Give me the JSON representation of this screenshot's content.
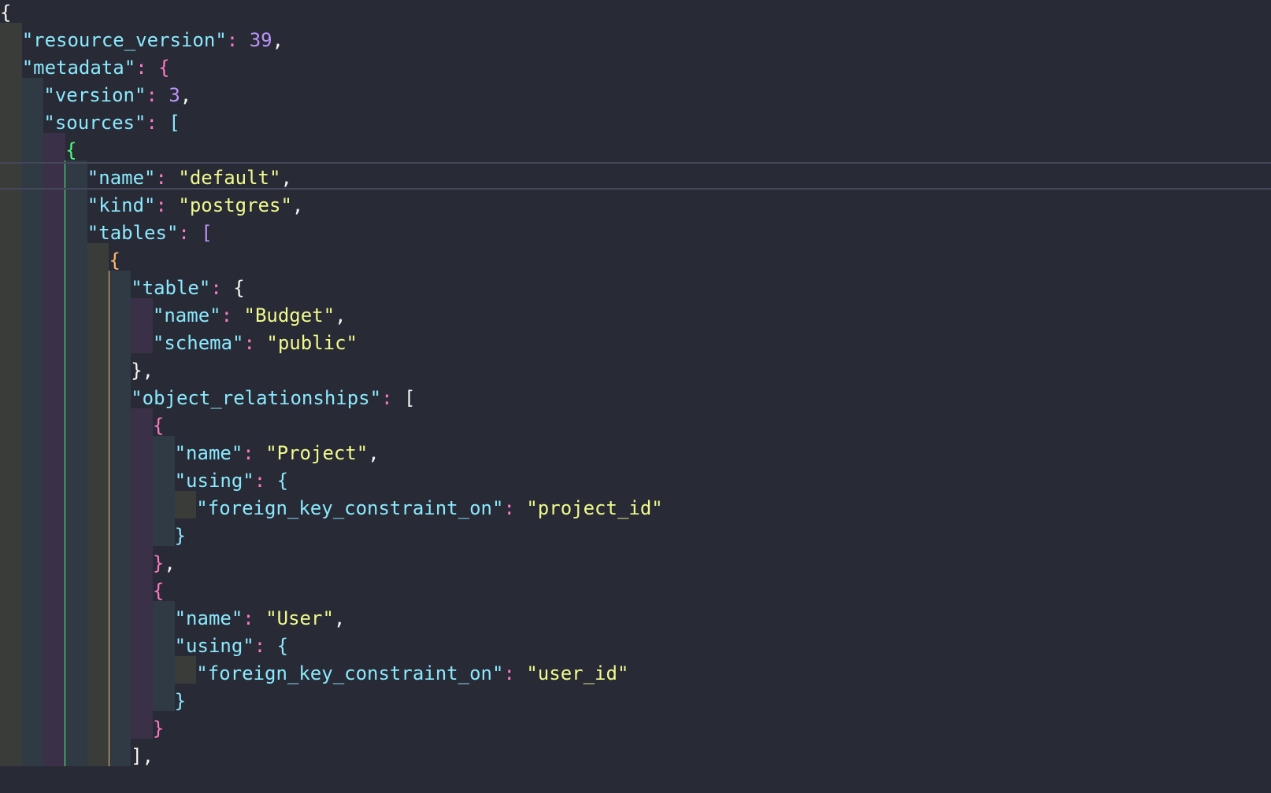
{
  "theme": {
    "background": "#282a36",
    "default": "#f8f8f2",
    "key": "#8be9fd",
    "string": "#f1fa8c",
    "number": "#bd93f9",
    "punct": "#ff79c6",
    "current_line_border": "#44475a",
    "bracket_colors": [
      "#f8f8f2",
      "#ff79c6",
      "#bd93f9",
      "#50fa7b",
      "#ffb86c",
      "#8be9fd"
    ]
  },
  "editor": {
    "language": "json",
    "current_line": 6,
    "lines": [
      {
        "indent": 0,
        "tokens": [
          {
            "t": "{",
            "c": "b0"
          }
        ]
      },
      {
        "indent": 1,
        "tokens": [
          {
            "t": "\"resource_version\"",
            "c": "key"
          },
          {
            "t": ": ",
            "c": "punct"
          },
          {
            "t": "39",
            "c": "number"
          },
          {
            "t": ",",
            "c": "default"
          }
        ]
      },
      {
        "indent": 1,
        "tokens": [
          {
            "t": "\"metadata\"",
            "c": "key"
          },
          {
            "t": ": ",
            "c": "punct"
          },
          {
            "t": "{",
            "c": "b1"
          }
        ]
      },
      {
        "indent": 2,
        "tokens": [
          {
            "t": "\"version\"",
            "c": "key"
          },
          {
            "t": ": ",
            "c": "punct"
          },
          {
            "t": "3",
            "c": "number"
          },
          {
            "t": ",",
            "c": "default"
          }
        ]
      },
      {
        "indent": 2,
        "tokens": [
          {
            "t": "\"sources\"",
            "c": "key"
          },
          {
            "t": ": ",
            "c": "punct"
          },
          {
            "t": "[",
            "c": "b5"
          }
        ]
      },
      {
        "indent": 3,
        "tokens": [
          {
            "t": "{",
            "c": "b3"
          }
        ]
      },
      {
        "indent": 4,
        "tokens": [
          {
            "t": "\"name\"",
            "c": "key"
          },
          {
            "t": ": ",
            "c": "punct"
          },
          {
            "t": "\"default\"",
            "c": "string"
          },
          {
            "t": ",",
            "c": "default"
          }
        ]
      },
      {
        "indent": 4,
        "tokens": [
          {
            "t": "\"kind\"",
            "c": "key"
          },
          {
            "t": ": ",
            "c": "punct"
          },
          {
            "t": "\"postgres\"",
            "c": "string"
          },
          {
            "t": ",",
            "c": "default"
          }
        ]
      },
      {
        "indent": 4,
        "tokens": [
          {
            "t": "\"tables\"",
            "c": "key"
          },
          {
            "t": ": ",
            "c": "punct"
          },
          {
            "t": "[",
            "c": "b2"
          }
        ]
      },
      {
        "indent": 5,
        "tokens": [
          {
            "t": "{",
            "c": "b4"
          }
        ]
      },
      {
        "indent": 6,
        "tokens": [
          {
            "t": "\"table\"",
            "c": "key"
          },
          {
            "t": ": ",
            "c": "punct"
          },
          {
            "t": "{",
            "c": "b0"
          }
        ]
      },
      {
        "indent": 7,
        "tokens": [
          {
            "t": "\"name\"",
            "c": "key"
          },
          {
            "t": ": ",
            "c": "punct"
          },
          {
            "t": "\"Budget\"",
            "c": "string"
          },
          {
            "t": ",",
            "c": "default"
          }
        ]
      },
      {
        "indent": 7,
        "tokens": [
          {
            "t": "\"schema\"",
            "c": "key"
          },
          {
            "t": ": ",
            "c": "punct"
          },
          {
            "t": "\"public\"",
            "c": "string"
          }
        ]
      },
      {
        "indent": 6,
        "tokens": [
          {
            "t": "}",
            "c": "b0"
          },
          {
            "t": ",",
            "c": "default"
          }
        ]
      },
      {
        "indent": 6,
        "tokens": [
          {
            "t": "\"object_relationships\"",
            "c": "key"
          },
          {
            "t": ": ",
            "c": "punct"
          },
          {
            "t": "[",
            "c": "b0"
          }
        ]
      },
      {
        "indent": 7,
        "tokens": [
          {
            "t": "{",
            "c": "b1"
          }
        ]
      },
      {
        "indent": 8,
        "tokens": [
          {
            "t": "\"name\"",
            "c": "key"
          },
          {
            "t": ": ",
            "c": "punct"
          },
          {
            "t": "\"Project\"",
            "c": "string"
          },
          {
            "t": ",",
            "c": "default"
          }
        ]
      },
      {
        "indent": 8,
        "tokens": [
          {
            "t": "\"using\"",
            "c": "key"
          },
          {
            "t": ": ",
            "c": "punct"
          },
          {
            "t": "{",
            "c": "b5"
          }
        ]
      },
      {
        "indent": 9,
        "tokens": [
          {
            "t": "\"foreign_key_constraint_on\"",
            "c": "key"
          },
          {
            "t": ": ",
            "c": "punct"
          },
          {
            "t": "\"project_id\"",
            "c": "string"
          }
        ]
      },
      {
        "indent": 8,
        "tokens": [
          {
            "t": "}",
            "c": "b5"
          }
        ]
      },
      {
        "indent": 7,
        "tokens": [
          {
            "t": "}",
            "c": "b1"
          },
          {
            "t": ",",
            "c": "default"
          }
        ]
      },
      {
        "indent": 7,
        "tokens": [
          {
            "t": "{",
            "c": "b1"
          }
        ]
      },
      {
        "indent": 8,
        "tokens": [
          {
            "t": "\"name\"",
            "c": "key"
          },
          {
            "t": ": ",
            "c": "punct"
          },
          {
            "t": "\"User\"",
            "c": "string"
          },
          {
            "t": ",",
            "c": "default"
          }
        ]
      },
      {
        "indent": 8,
        "tokens": [
          {
            "t": "\"using\"",
            "c": "key"
          },
          {
            "t": ": ",
            "c": "punct"
          },
          {
            "t": "{",
            "c": "b5"
          }
        ]
      },
      {
        "indent": 9,
        "tokens": [
          {
            "t": "\"foreign_key_constraint_on\"",
            "c": "key"
          },
          {
            "t": ": ",
            "c": "punct"
          },
          {
            "t": "\"user_id\"",
            "c": "string"
          }
        ]
      },
      {
        "indent": 8,
        "tokens": [
          {
            "t": "}",
            "c": "b5"
          }
        ]
      },
      {
        "indent": 7,
        "tokens": [
          {
            "t": "}",
            "c": "b1"
          }
        ]
      },
      {
        "indent": 6,
        "tokens": [
          {
            "t": "]",
            "c": "b0"
          },
          {
            "t": ",",
            "c": "default"
          }
        ]
      }
    ],
    "indent_guides": [
      {
        "level": 0,
        "color": "#3a3c3a",
        "from": 1,
        "to": 27
      },
      {
        "level": 1,
        "color": "#2f3a44",
        "from": 3,
        "to": 27
      },
      {
        "level": 2,
        "color": "#3a3048",
        "from": 5,
        "to": 27
      },
      {
        "level": 3,
        "color": "#50fa7b",
        "line": true,
        "from": 6,
        "to": 27
      },
      {
        "level": 3,
        "color": "#2f3a44",
        "from": 6,
        "to": 27
      },
      {
        "level": 4,
        "color": "#3a3c3a",
        "from": 9,
        "to": 27
      },
      {
        "level": 4,
        "color": "#ffb86c",
        "line": true,
        "from": 10,
        "to": 27
      },
      {
        "level": 5,
        "color": "#2f3a44",
        "from": 10,
        "to": 27
      },
      {
        "level": 6,
        "color": "#3a3048",
        "from": 11,
        "to": 12
      },
      {
        "level": 6,
        "color": "#3a3048",
        "from": 15,
        "to": 26
      },
      {
        "level": 7,
        "color": "#2f3a44",
        "from": 16,
        "to": 19
      },
      {
        "level": 7,
        "color": "#2f3a44",
        "from": 22,
        "to": 25
      },
      {
        "level": 8,
        "color": "#3a3c3a",
        "from": 18,
        "to": 18
      },
      {
        "level": 8,
        "color": "#3a3c3a",
        "from": 24,
        "to": 24
      }
    ]
  }
}
